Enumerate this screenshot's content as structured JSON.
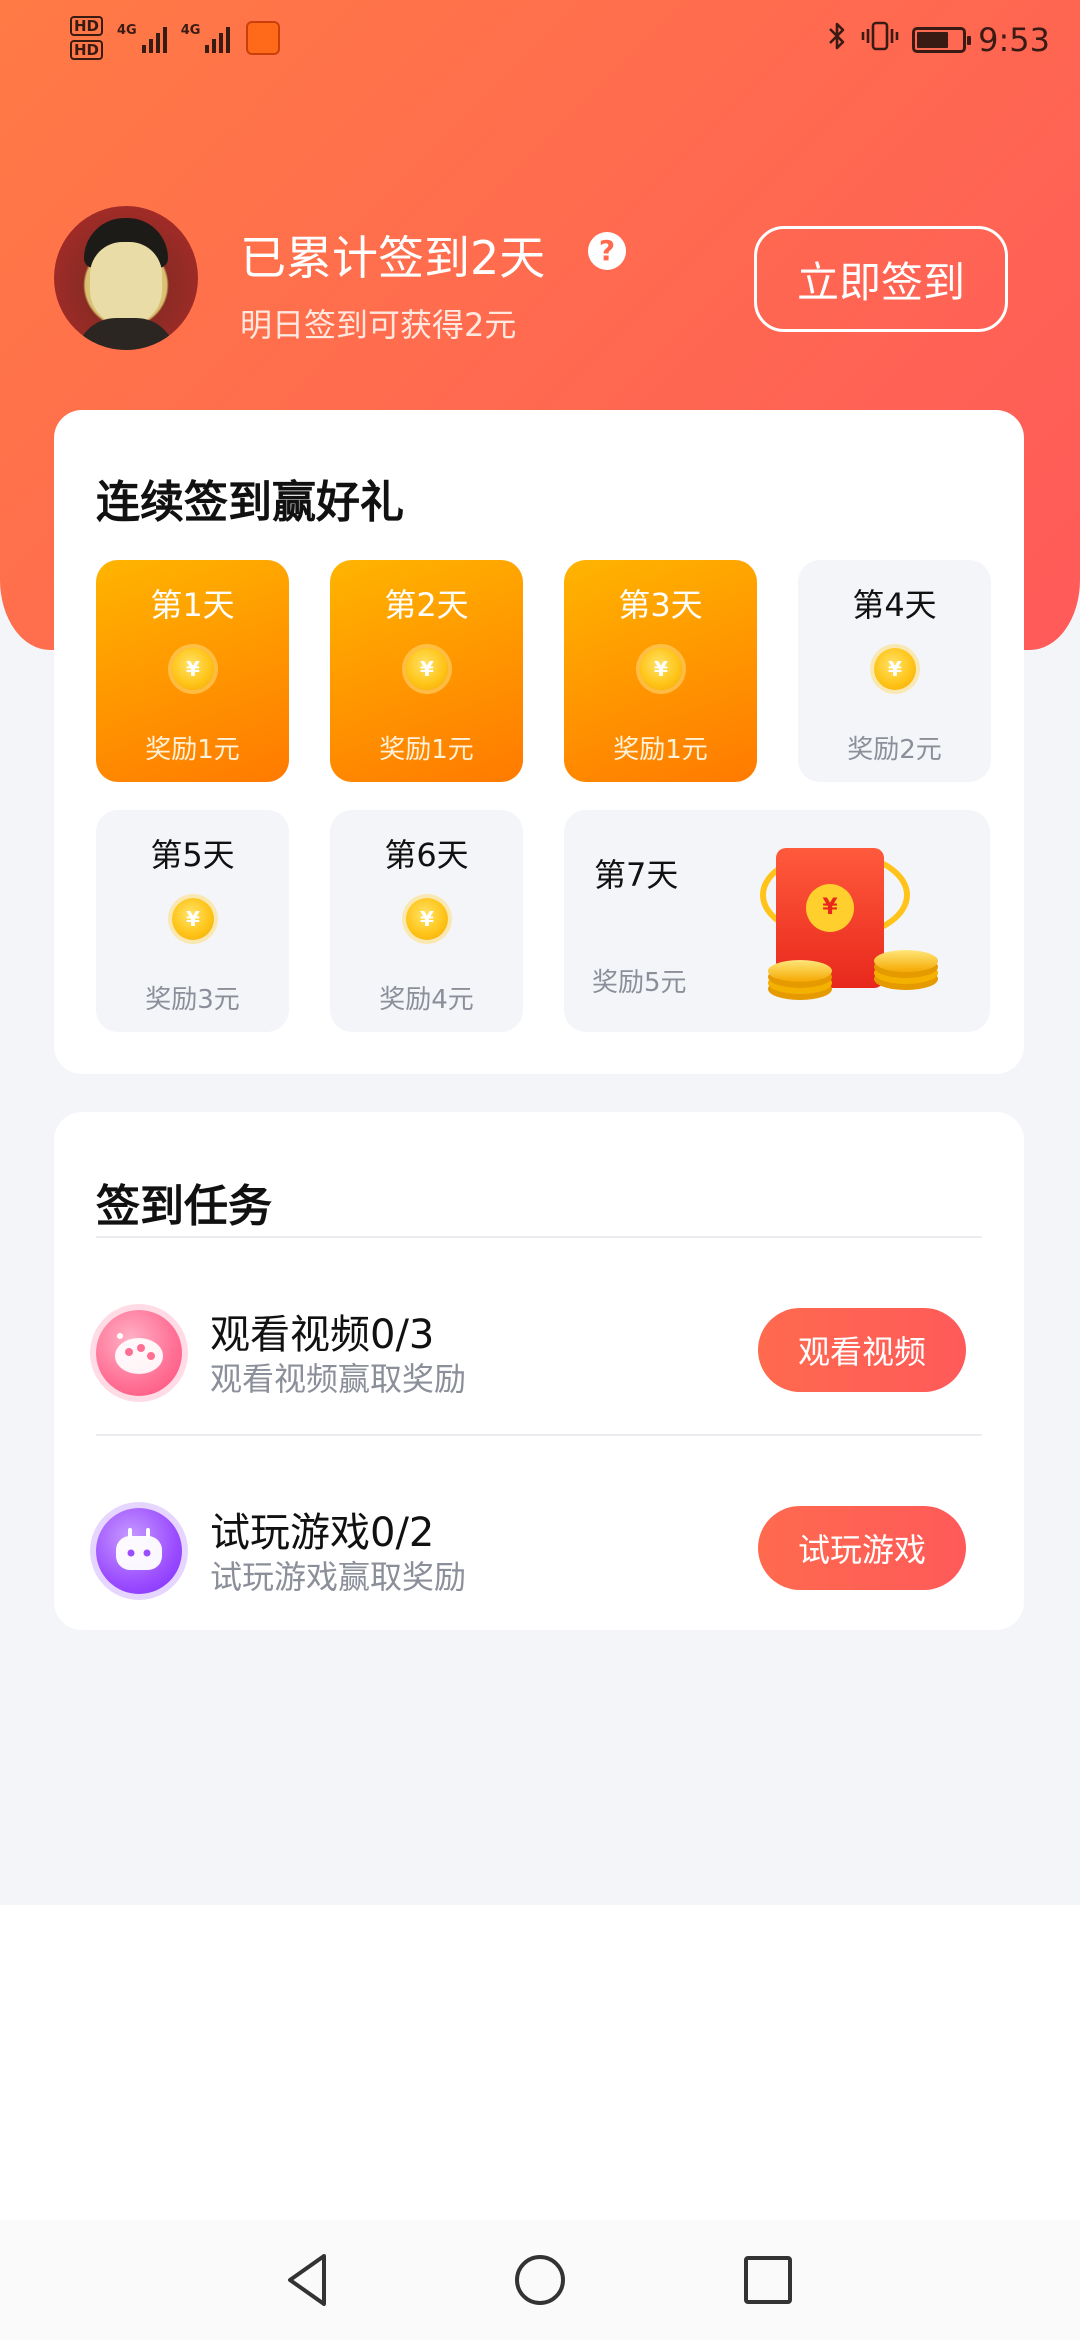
{
  "status_bar": {
    "hd1": "HD",
    "hd2": "HD",
    "net1": "4G",
    "net2": "4G",
    "time": "9:53",
    "icons": [
      "bluetooth-icon",
      "vibrate-icon",
      "battery-icon"
    ]
  },
  "header": {
    "checkin_count": "已累计签到2天",
    "tomorrow_hint": "明日签到可获得2元",
    "help": "?",
    "checkin_button": "立即签到"
  },
  "rewards": {
    "title": "连续签到赢好礼",
    "coin_symbol": "¥",
    "days": [
      {
        "label": "第1天",
        "reward": "奖励1元",
        "done": true
      },
      {
        "label": "第2天",
        "reward": "奖励1元",
        "done": true
      },
      {
        "label": "第3天",
        "reward": "奖励1元",
        "done": true
      },
      {
        "label": "第4天",
        "reward": "奖励2元",
        "done": false
      },
      {
        "label": "第5天",
        "reward": "奖励3元",
        "done": false
      },
      {
        "label": "第6天",
        "reward": "奖励4元",
        "done": false
      }
    ],
    "day7": {
      "label": "第7天",
      "reward": "奖励5元"
    }
  },
  "tasks": {
    "title": "签到任务",
    "items": [
      {
        "title": "观看视频0/3",
        "subtitle": "观看视频赢取奖励",
        "button": "观看视频",
        "icon": "palette-icon"
      },
      {
        "title": "试玩游戏0/2",
        "subtitle": "试玩游戏赢取奖励",
        "button": "试玩游戏",
        "icon": "game-icon"
      }
    ]
  },
  "colors": {
    "header_gradient_start": "#ff7a45",
    "header_gradient_end": "#ff5a5a",
    "day_done_start": "#ffb400",
    "day_done_end": "#ff7a00",
    "task_button": "#ff6a4e"
  }
}
